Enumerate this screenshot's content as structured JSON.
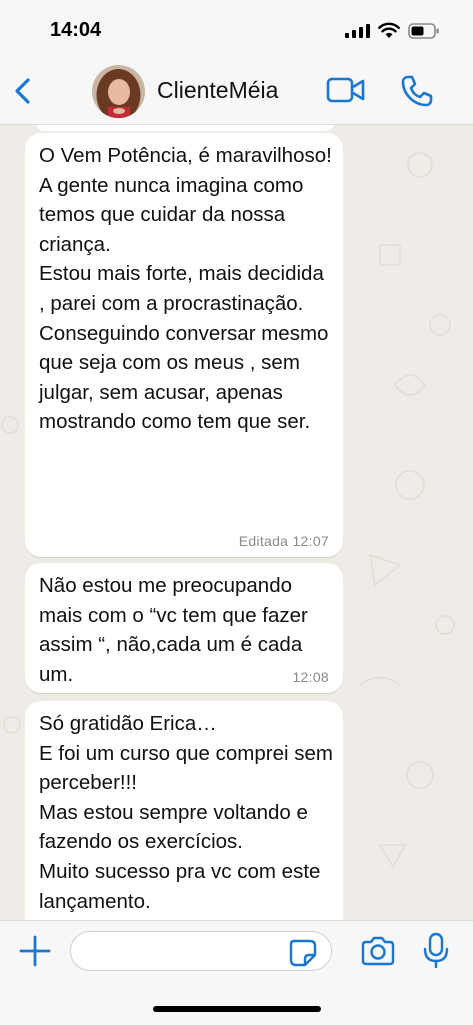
{
  "status_bar": {
    "time": "14:04"
  },
  "header": {
    "contact_name": "ClienteMéia"
  },
  "messages": [
    {
      "text": "O Vem Potência, é maravilhoso!\nA gente nunca imagina como temos que cuidar da nossa criança.\nEstou mais forte, mais decidida , parei com a procrastinação.\nConseguindo conversar mesmo que  seja com os meus , sem julgar, sem acusar, apenas mostrando como tem que ser.",
      "meta": "Editada 12:07"
    },
    {
      "text": "Não estou me preocupando mais com o “vc tem que fazer assim “, não,cada um é cada um.",
      "meta": "12:08"
    },
    {
      "text": "Só gratidão Erica…\nE foi um curso que comprei sem perceber!!!\nMas estou sempre voltando e fazendo os exercícios.\nMuito sucesso pra vc com este lançamento.",
      "meta": ""
    }
  ],
  "input": {
    "value": "",
    "placeholder": ""
  },
  "colors": {
    "accent": "#1877d2",
    "chat_bg": "#efebe6",
    "bubble": "#ffffff"
  },
  "icons": {
    "back": "chevron-left-icon",
    "video": "video-camera-icon",
    "phone": "phone-icon",
    "plus": "plus-icon",
    "sticker": "sticker-icon",
    "camera": "camera-icon",
    "mic": "microphone-icon"
  }
}
